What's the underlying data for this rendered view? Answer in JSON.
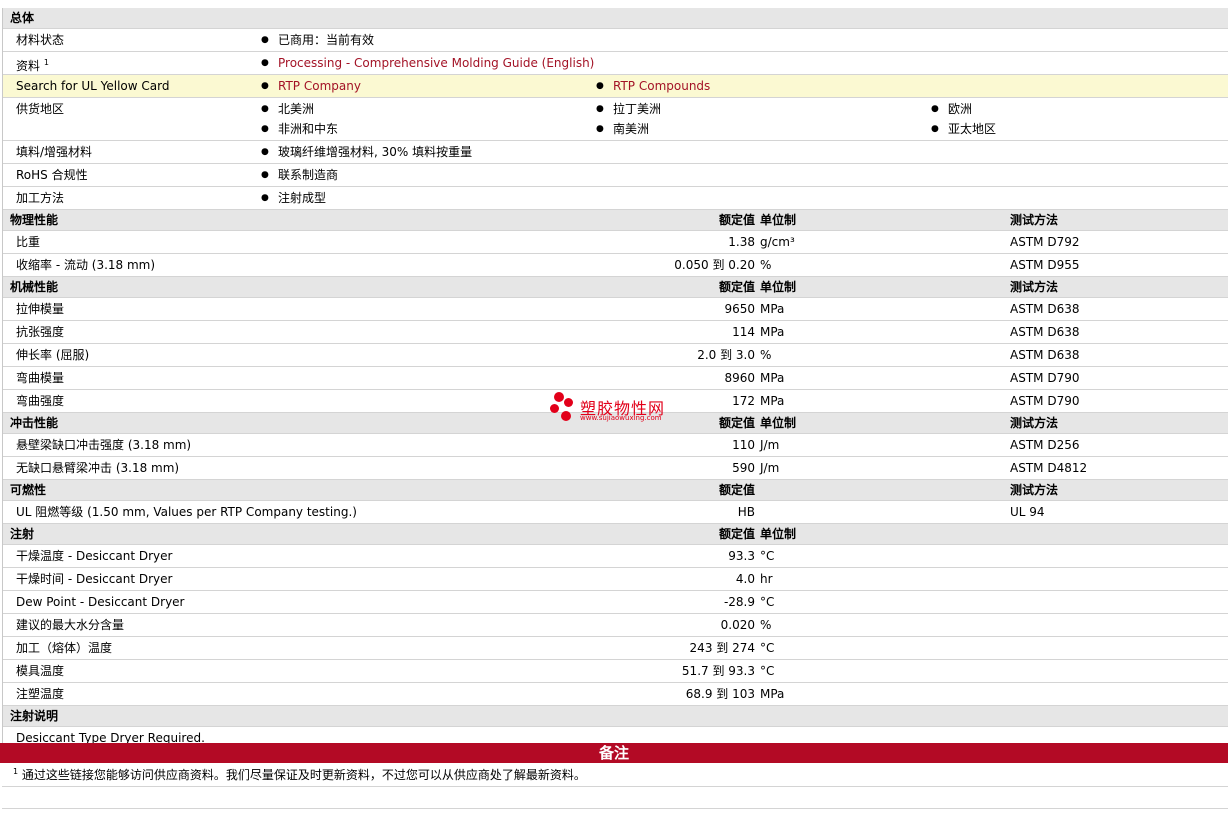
{
  "sections": {
    "general": {
      "title": "总体",
      "material_status": {
        "label": "材料状态",
        "value": "已商用：当前有效"
      },
      "literature": {
        "label": "资料",
        "sup": "1",
        "link": "Processing - Comprehensive Molding Guide (English)"
      },
      "ul": {
        "label": "Search for UL Yellow Card",
        "link1": "RTP Company",
        "link2": "RTP Compounds"
      },
      "regions": {
        "label": "供货地区",
        "items": [
          "北美洲",
          "拉丁美洲",
          "欧洲",
          "非洲和中东",
          "南美洲",
          "亚太地区"
        ]
      },
      "filler": {
        "label": "填料/增强材料",
        "value": "玻璃纤维增强材料, 30% 填料按重量"
      },
      "rohs": {
        "label": "RoHS 合规性",
        "value": "联系制造商"
      },
      "process": {
        "label": "加工方法",
        "value": "注射成型"
      }
    },
    "physical": {
      "title": "物理性能",
      "h_value": "额定值",
      "h_unit": "单位制",
      "h_test": "测试方法",
      "rows": [
        {
          "label": "比重",
          "value": "1.38",
          "unit": "g/cm³",
          "test": "ASTM D792"
        },
        {
          "label": "收缩率  - 流动  (3.18 mm)",
          "value": "0.050 到  0.20",
          "unit": "%",
          "test": "ASTM D955"
        }
      ]
    },
    "mechanical": {
      "title": "机械性能",
      "h_value": "额定值",
      "h_unit": "单位制",
      "h_test": "测试方法",
      "rows": [
        {
          "label": "拉伸模量",
          "value": "9650",
          "unit": "MPa",
          "test": "ASTM D638"
        },
        {
          "label": "抗张强度",
          "value": "114",
          "unit": "MPa",
          "test": "ASTM D638"
        },
        {
          "label": "伸长率  (屈服)",
          "value": "2.0 到  3.0",
          "unit": "%",
          "test": "ASTM D638"
        },
        {
          "label": "弯曲模量",
          "value": "8960",
          "unit": "MPa",
          "test": "ASTM D790"
        },
        {
          "label": "弯曲强度",
          "value": "172",
          "unit": "MPa",
          "test": "ASTM D790"
        }
      ]
    },
    "impact": {
      "title": "冲击性能",
      "h_value": "额定值",
      "h_unit": "单位制",
      "h_test": "测试方法",
      "rows": [
        {
          "label": "悬壁梁缺口冲击强度  (3.18 mm)",
          "value": "110",
          "unit": "J/m",
          "test": "ASTM D256"
        },
        {
          "label": "无缺口悬臂梁冲击  (3.18 mm)",
          "value": "590",
          "unit": "J/m",
          "test": "ASTM D4812"
        }
      ]
    },
    "flammability": {
      "title": "可燃性",
      "h_value": "额定值",
      "h_test": "测试方法",
      "rows": [
        {
          "label": "UL 阻燃等级  (1.50 mm, Values per RTP Company testing.)",
          "value": "HB",
          "unit": "",
          "test": "UL 94"
        }
      ]
    },
    "injection": {
      "title": "注射",
      "h_value": "额定值",
      "h_unit": "单位制",
      "rows": [
        {
          "label": "干燥温度  - Desiccant Dryer",
          "value": "93.3",
          "unit": "°C"
        },
        {
          "label": "干燥时间  - Desiccant Dryer",
          "value": "4.0",
          "unit": "hr"
        },
        {
          "label": "Dew Point - Desiccant Dryer",
          "value": "-28.9",
          "unit": "°C"
        },
        {
          "label": "建议的最大水分含量",
          "value": "0.020",
          "unit": "%"
        },
        {
          "label": "加工（熔体）温度",
          "value": "243 到  274",
          "unit": "°C"
        },
        {
          "label": "模具温度",
          "value": "51.7 到  93.3",
          "unit": "°C"
        },
        {
          "label": "注塑温度",
          "value": "68.9 到  103",
          "unit": "MPa"
        }
      ]
    },
    "injection_notes": {
      "title": "注射说明",
      "text": "Desiccant Type Dryer Required."
    }
  },
  "notes": {
    "title": "备注",
    "sup": "1",
    "text": "通过这些链接您能够访问供应商资料。我们尽量保证及时更新资料，不过您可以从供应商处了解最新资料。"
  },
  "watermark": {
    "name": "塑胶物性网",
    "url": "www.sujiaowuxing.com"
  }
}
